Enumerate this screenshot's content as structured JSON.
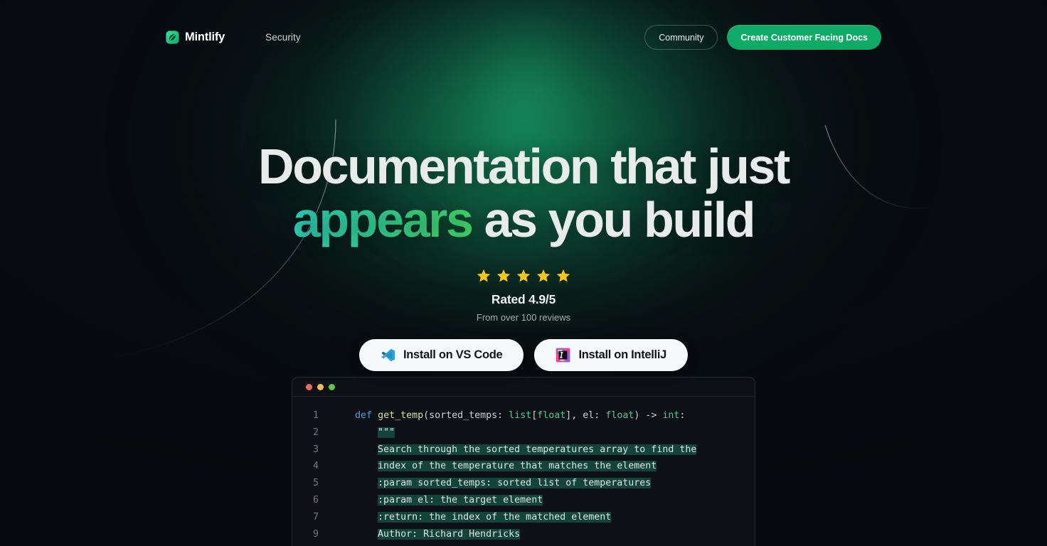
{
  "colors": {
    "brand_green": "#0fa968",
    "accent_teal": "#2fd6c0",
    "accent_green": "#44dd6e",
    "page_bg": "#080c10",
    "code_bg": "#0d1116",
    "docstring_highlight": "#12443a",
    "star_gold": "#f5c518"
  },
  "nav": {
    "brand": {
      "name": "Mintlify",
      "icon": "mintlify-leaf-icon"
    },
    "links": [
      {
        "label": "Security",
        "name": "nav-link-security"
      }
    ],
    "community_label": "Community",
    "cta_label": "Create Customer Facing Docs"
  },
  "hero": {
    "headline_line1": "Documentation that just",
    "headline_line2_accent": "appears",
    "headline_line2_rest": " as you build",
    "stars": {
      "count": 5,
      "icon": "star-icon"
    },
    "rating_text": "Rated 4.9/5",
    "reviews_text": "From over 100 reviews",
    "cta_vscode": {
      "label": "Install on VS Code",
      "icon": "vscode-icon"
    },
    "cta_intellij": {
      "label": "Install on IntelliJ",
      "icon": "intellij-icon"
    }
  },
  "code_window": {
    "traffic_lights": [
      "close-red",
      "minimize-yellow",
      "maximize-green"
    ],
    "language": "python",
    "lines": [
      {
        "number": "1",
        "highlight": false,
        "tokens": [
          {
            "t": "    ",
            "c": "plain"
          },
          {
            "t": "def ",
            "c": "kw"
          },
          {
            "t": "get_temp",
            "c": "fn"
          },
          {
            "t": "(sorted_temps: ",
            "c": "plain"
          },
          {
            "t": "list",
            "c": "type"
          },
          {
            "t": "[",
            "c": "plain"
          },
          {
            "t": "float",
            "c": "type"
          },
          {
            "t": "], el: ",
            "c": "plain"
          },
          {
            "t": "float",
            "c": "type"
          },
          {
            "t": ") -> ",
            "c": "plain"
          },
          {
            "t": "int",
            "c": "type"
          },
          {
            "t": ":",
            "c": "plain"
          }
        ]
      },
      {
        "number": "2",
        "highlight": true,
        "indent": "        ",
        "text": "\"\"\""
      },
      {
        "number": "3",
        "highlight": true,
        "indent": "        ",
        "text": "Search through the sorted temperatures array to find the"
      },
      {
        "number": "4",
        "highlight": true,
        "indent": "        ",
        "text": "index of the temperature that matches the element"
      },
      {
        "number": "5",
        "highlight": true,
        "indent": "        ",
        "text": ":param sorted_temps: sorted list of temperatures"
      },
      {
        "number": "6",
        "highlight": true,
        "indent": "        ",
        "text": ":param el: the target element"
      },
      {
        "number": "7",
        "highlight": true,
        "indent": "        ",
        "text": ":return: the index of the matched element"
      },
      {
        "number": "9",
        "highlight": true,
        "indent": "        ",
        "text": "Author: Richard Hendricks"
      }
    ]
  }
}
